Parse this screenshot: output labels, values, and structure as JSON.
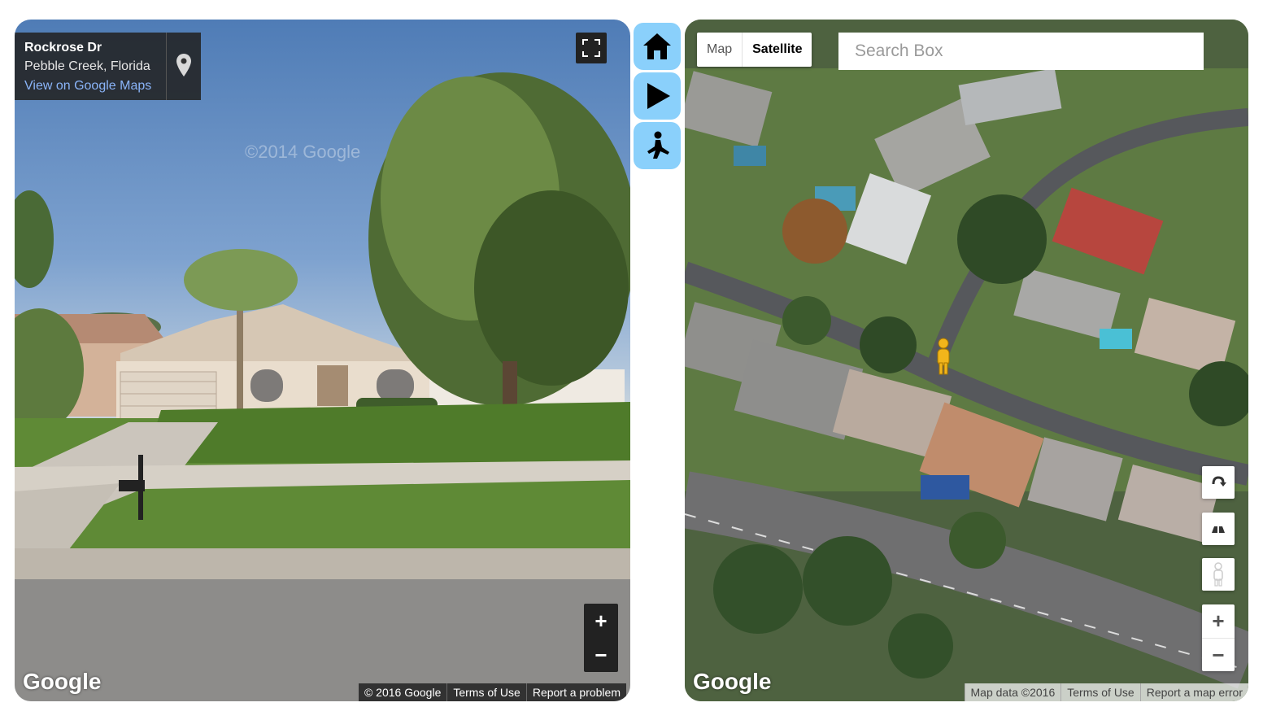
{
  "street_view": {
    "street": "Rockrose Dr",
    "locality": "Pebble Creek, Florida",
    "maps_link": "View on Google Maps",
    "watermark": "©2014 Google",
    "logo": "Google",
    "attribution": [
      "© 2016 Google",
      "Terms of Use",
      "Report a problem"
    ],
    "zoom_in": "+",
    "zoom_out": "−"
  },
  "sidebar": {
    "buttons": [
      "home-icon",
      "play-icon",
      "pegman-icon"
    ],
    "accent": "#8ad0fb"
  },
  "map": {
    "type_map": "Map",
    "type_satellite": "Satellite",
    "search_placeholder": "Search Box",
    "logo": "Google",
    "attribution": [
      "Map data ©2016",
      "Terms of Use",
      "Report a map error"
    ],
    "zoom_in": "+",
    "zoom_out": "−"
  }
}
